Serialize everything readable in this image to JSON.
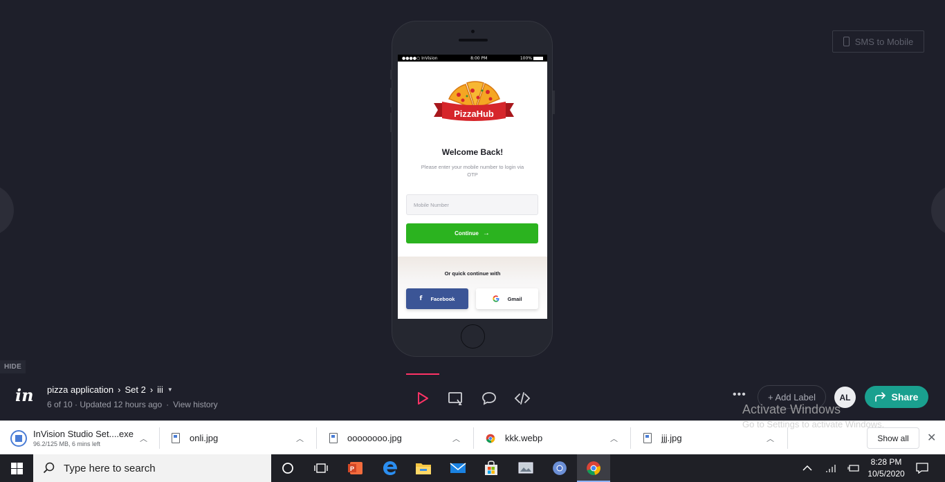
{
  "stage": {
    "sms_button_label": "SMS to Mobile",
    "hide_label": "HIDE"
  },
  "phone_screen": {
    "status": {
      "carrier": "●●●●○ InVision",
      "time": "8:00 PM",
      "battery": "100%"
    },
    "logo_text": "PizzaHub",
    "welcome_title": "Welcome Back!",
    "subtitle": "Please enter your mobile number to login via OTP",
    "mobile_placeholder": "Mobile Number",
    "continue_label": "Continue",
    "quick_label": "Or quick continue with",
    "facebook_label": "Facebook",
    "gmail_label": "Gmail",
    "colors": {
      "continue": "#2bb31f",
      "facebook": "#3b5596",
      "ribbon": "#d6262b"
    }
  },
  "invision_bar": {
    "project": "pizza application",
    "set": "Set 2",
    "screen": "iii",
    "meta": "6 of 10 · Updated 12 hours ago",
    "view_history": "View history",
    "modes": [
      "preview-play-icon",
      "comment-screen-icon",
      "chat-bubble-icon",
      "code-inspect-icon"
    ],
    "add_label": "+ Add Label",
    "avatar_initials": "AL",
    "share_label": "Share",
    "accent": "#1aa08f"
  },
  "downloads": {
    "items": [
      {
        "name": "InVision Studio Set....exe",
        "sub": "96.2/125 MB, 6 mins left"
      },
      {
        "name": "onli.jpg"
      },
      {
        "name": "oooooooo.jpg"
      },
      {
        "name": "kkk.webp"
      },
      {
        "name": "jjj.jpg"
      }
    ],
    "show_all": "Show all",
    "watermark_title": "Activate Windows",
    "watermark_sub": "Go to Settings to activate Windows."
  },
  "taskbar": {
    "search_placeholder": "Type here to search",
    "time": "8:28 PM",
    "date": "10/5/2020"
  }
}
